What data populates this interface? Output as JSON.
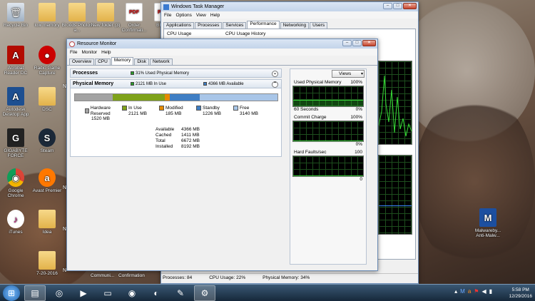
{
  "desktop": {
    "icons": [
      {
        "label": "Recycle Bin",
        "glyph": "🗑",
        "kind": "app"
      },
      {
        "label": "low memory",
        "glyph": "",
        "kind": "folder"
      },
      {
        "label": "Broods Photos a...",
        "glyph": "",
        "kind": "folder"
      },
      {
        "label": "New folder (3)",
        "glyph": "",
        "kind": "folder"
      },
      {
        "label": "Order Confirmati...",
        "glyph": "PDF",
        "kind": "pdf"
      },
      {
        "label": "BENE",
        "glyph": "PDF",
        "kind": "pdf"
      },
      {
        "label": "Acrobat Reader DC",
        "glyph": "A",
        "kind": "acrobat"
      },
      {
        "label": "Radio Game Capture",
        "glyph": "●",
        "kind": "record"
      },
      {
        "label": "Autodesk Desktop App",
        "glyph": "A",
        "kind": "autodesk"
      },
      {
        "label": "DSC",
        "glyph": "",
        "kind": "folder"
      },
      {
        "label": "GIGABYTE FORCE",
        "glyph": "G",
        "kind": "gigabyte"
      },
      {
        "label": "Steam",
        "glyph": "S",
        "kind": "steam"
      },
      {
        "label": "Google Chrome",
        "glyph": "◉",
        "kind": "chrome"
      },
      {
        "label": "Avast Premier",
        "glyph": "a",
        "kind": "avast"
      },
      {
        "label": "iTunes",
        "glyph": "♪",
        "kind": "itunes"
      },
      {
        "label": "Idea",
        "glyph": "",
        "kind": "folder"
      },
      {
        "label": "",
        "glyph": "",
        "kind": "folder"
      },
      {
        "label": "7-20-2016",
        "glyph": "",
        "kind": "folder"
      },
      {
        "label": "Malwareby... Anti-Malw...",
        "glyph": "M",
        "kind": "malwarebytes"
      }
    ],
    "partial_labels": [
      "N",
      "N",
      "N",
      "N"
    ],
    "behind_window_labels": [
      "Communi...",
      "Confirmation"
    ]
  },
  "task_manager": {
    "title": "Windows Task Manager",
    "menu": [
      "File",
      "Options",
      "View",
      "Help"
    ],
    "tabs": [
      "Applications",
      "Processes",
      "Services",
      "Performance",
      "Networking",
      "Users"
    ],
    "active_tab": "Performance",
    "labels": {
      "cpu_usage": "CPU Usage",
      "cpu_history": "CPU Usage History"
    },
    "status": {
      "processes": "Processes: 84",
      "cpu": "CPU Usage: 22%",
      "memory": "Physical Memory: 34%"
    }
  },
  "resource_monitor": {
    "title": "Resource Monitor",
    "menu": [
      "File",
      "Monitor",
      "Help"
    ],
    "tabs": [
      "Overview",
      "CPU",
      "Memory",
      "Disk",
      "Network"
    ],
    "active_tab": "Memory",
    "processes_section": {
      "label": "Processes",
      "summary": "31% Used Physical Memory",
      "summary_color": "#2a9d2a"
    },
    "physical_memory_section": {
      "label": "Physical Memory",
      "in_use_summary": "2121 MB In Use",
      "available_summary": "4366 MB Available",
      "bar": [
        {
          "name": "Hardware Reserved",
          "mb": 1520,
          "color": "#a3a3a3"
        },
        {
          "name": "In Use",
          "mb": 2121,
          "color": "#7fa21a"
        },
        {
          "name": "Modified",
          "mb": 185,
          "color": "#e68a00"
        },
        {
          "name": "Standby",
          "mb": 1226,
          "color": "#3f7ec4"
        },
        {
          "name": "Free",
          "mb": 3140,
          "color": "#a9c6e8"
        }
      ],
      "legend": [
        {
          "label": "Hardware Reserved",
          "value": "1520 MB",
          "color": "#a3a3a3"
        },
        {
          "label": "In Use",
          "value": "2121 MB",
          "color": "#7fa21a"
        },
        {
          "label": "Modified",
          "value": "185 MB",
          "color": "#e68a00"
        },
        {
          "label": "Standby",
          "value": "1226 MB",
          "color": "#3f7ec4"
        },
        {
          "label": "Free",
          "value": "3140 MB",
          "color": "#a9c6e8"
        }
      ],
      "totals": [
        {
          "label": "Available",
          "value": "4366 MB"
        },
        {
          "label": "Cached",
          "value": "1411 MB"
        },
        {
          "label": "Total",
          "value": "6672 MB"
        },
        {
          "label": "Installed",
          "value": "8192 MB"
        }
      ]
    },
    "views_button": "Views",
    "graphs": [
      {
        "title": "Used Physical Memory",
        "top": "100%",
        "foot_left": "60 Seconds",
        "foot_right": "0%",
        "level": 0.31
      },
      {
        "title": "Commit Charge",
        "top": "100%",
        "foot_left": "",
        "foot_right": "0%",
        "level": 0.0
      },
      {
        "title": "Hard Faults/sec",
        "top": "100",
        "foot_left": "",
        "foot_right": "0",
        "level": 0.0
      }
    ]
  },
  "taskbar": {
    "items": [
      {
        "name": "start-orb",
        "glyph": "⊞"
      },
      {
        "name": "taskbar-resource-monitor",
        "glyph": "▤"
      },
      {
        "name": "taskbar-wifi",
        "glyph": "◎"
      },
      {
        "name": "taskbar-media",
        "glyph": "▶"
      },
      {
        "name": "taskbar-explorer",
        "glyph": "▭"
      },
      {
        "name": "taskbar-chrome",
        "glyph": "◉"
      },
      {
        "name": "taskbar-firefox",
        "glyph": "◐"
      },
      {
        "name": "taskbar-paint",
        "glyph": "✎"
      },
      {
        "name": "taskbar-settings",
        "glyph": "⚙"
      }
    ],
    "clock_time": "5:58 PM",
    "clock_date": "12/29/2016"
  }
}
